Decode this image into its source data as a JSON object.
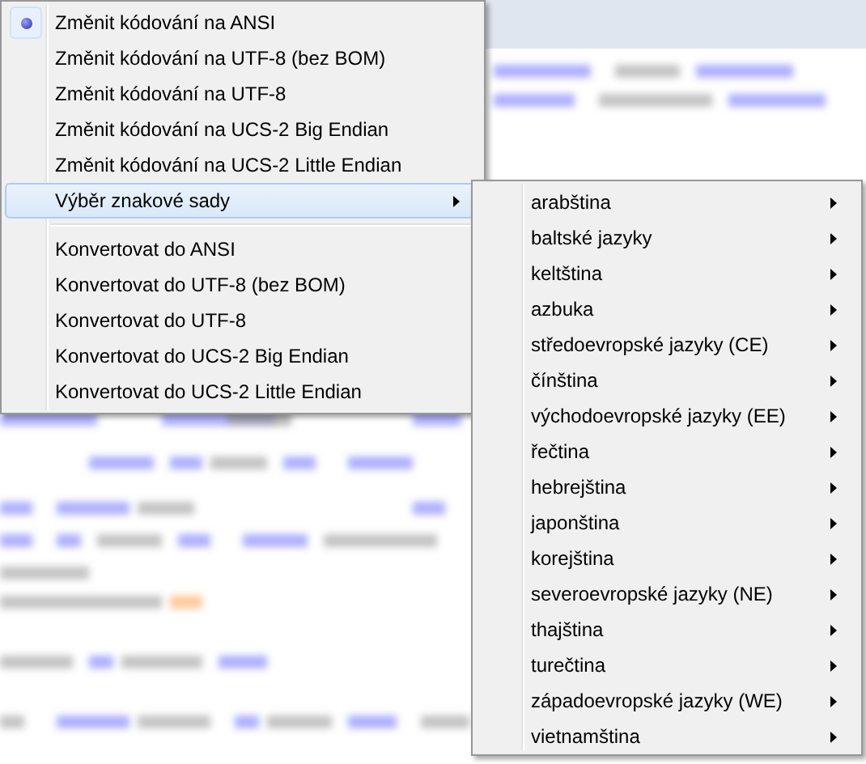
{
  "menu": {
    "items": [
      {
        "kind": "radio",
        "label": "Změnit kódování na ANSI",
        "checked": true
      },
      {
        "kind": "radio",
        "label": "Změnit kódování na UTF-8 (bez BOM)",
        "checked": false
      },
      {
        "kind": "radio",
        "label": "Změnit kódování na UTF-8",
        "checked": false
      },
      {
        "kind": "radio",
        "label": "Změnit kódování na UCS-2 Big Endian",
        "checked": false
      },
      {
        "kind": "radio",
        "label": "Změnit kódování na UCS-2 Little Endian",
        "checked": false
      },
      {
        "kind": "submenu",
        "label": "Výběr znakové sady",
        "selected": true
      },
      {
        "kind": "separator"
      },
      {
        "kind": "command",
        "label": "Konvertovat do ANSI"
      },
      {
        "kind": "command",
        "label": "Konvertovat do UTF-8 (bez BOM)"
      },
      {
        "kind": "command",
        "label": "Konvertovat do UTF-8"
      },
      {
        "kind": "command",
        "label": "Konvertovat do UCS-2 Big Endian"
      },
      {
        "kind": "command",
        "label": "Konvertovat do UCS-2 Little Endian"
      }
    ]
  },
  "submenu": {
    "items": [
      {
        "label": "arabština",
        "selected": false
      },
      {
        "label": "baltské jazyky",
        "selected": false
      },
      {
        "label": "keltština",
        "selected": false
      },
      {
        "label": "azbuka",
        "selected": false
      },
      {
        "label": "středoevropské jazyky (CE)",
        "selected": false
      },
      {
        "label": "čínština",
        "selected": false
      },
      {
        "label": "východoevropské jazyky (EE)",
        "selected": false
      },
      {
        "label": "řečtina",
        "selected": false
      },
      {
        "label": "hebrejština",
        "selected": false
      },
      {
        "label": "japonština",
        "selected": false
      },
      {
        "label": "korejština",
        "selected": false
      },
      {
        "label": "severoevropské jazyky (NE)",
        "selected": false
      },
      {
        "label": "thajština",
        "selected": false
      },
      {
        "label": "turečtina",
        "selected": false
      },
      {
        "label": "západoevropské jazyky (WE)",
        "selected": false
      },
      {
        "label": "vietnamština",
        "selected": false
      }
    ]
  }
}
